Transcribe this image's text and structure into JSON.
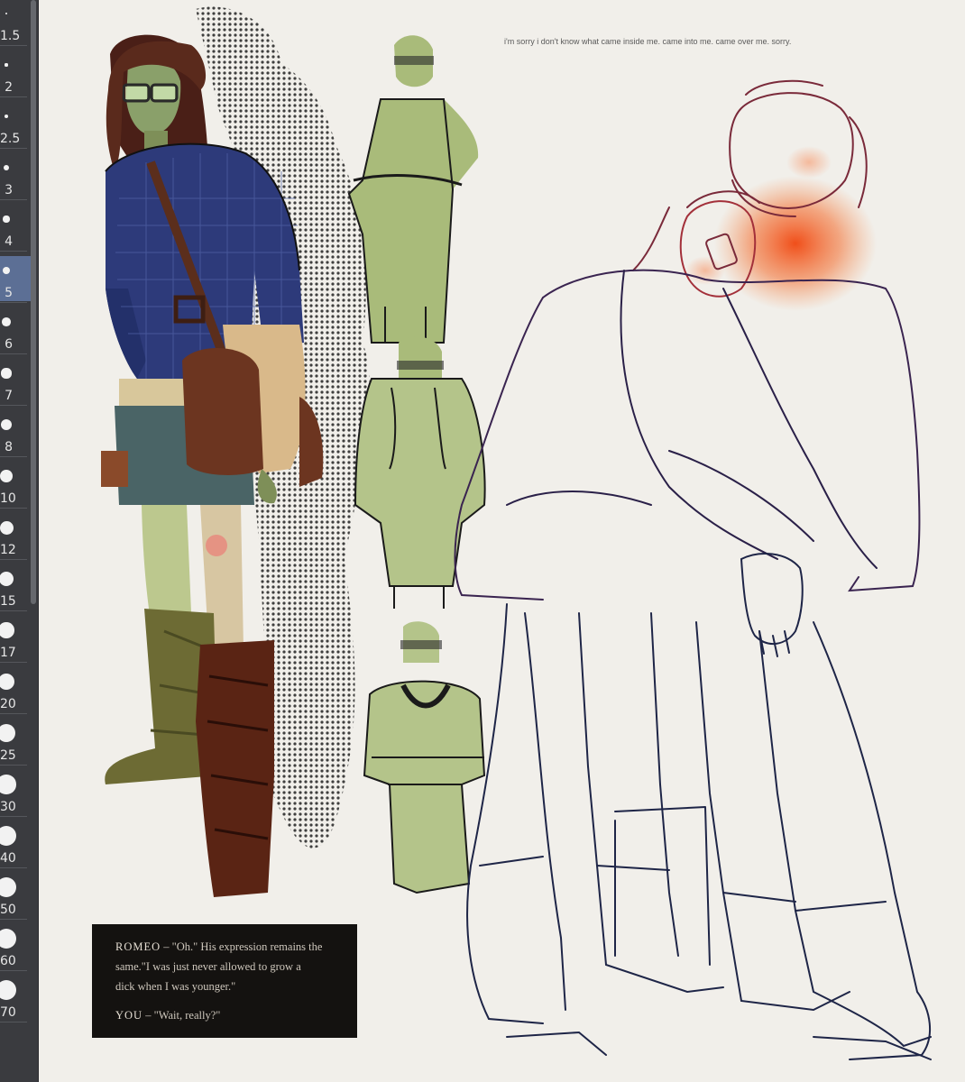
{
  "sidebar": {
    "brush_sizes": [
      "1.5",
      "2",
      "2.5",
      "3",
      "4",
      "5",
      "6",
      "7",
      "8",
      "10",
      "12",
      "15",
      "17",
      "20",
      "25",
      "30",
      "40",
      "50",
      "60",
      "70"
    ],
    "selected_index": 5
  },
  "canvas": {
    "note": "i'm sorry i don't know what came inside me. came into me. came over me. sorry.",
    "dialogue": {
      "speaker1": "ROMEO",
      "line1a": "– \"Oh.\" His expression remains the",
      "line1b": "same.\"I was just never allowed to grow a",
      "line1c": "dick when I was younger.\"",
      "speaker2": "YOU",
      "line2": "– \"Wait, really?\""
    }
  },
  "colors": {
    "sidebar_bg": "#3a3b3f",
    "selected_brush": "#5c6f95",
    "canvas_bg": "#f1efea",
    "dialogue_bg": "#141210",
    "green_sketch": "#a9bb7a",
    "navy_line": "#1e2547",
    "blush_orange": "#f25a1d"
  }
}
